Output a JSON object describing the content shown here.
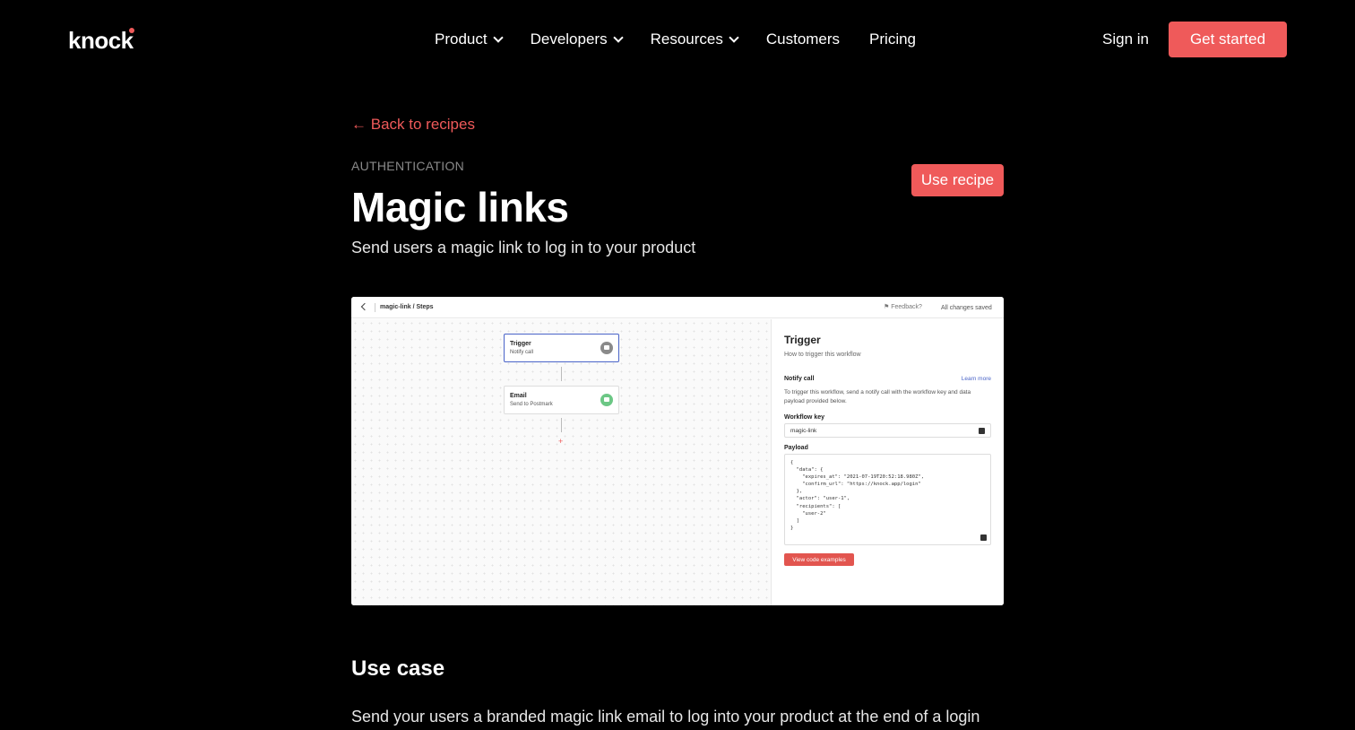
{
  "nav": {
    "logo": "knock",
    "links": [
      {
        "label": "Product",
        "dropdown": true
      },
      {
        "label": "Developers",
        "dropdown": true
      },
      {
        "label": "Resources",
        "dropdown": true
      },
      {
        "label": "Customers",
        "dropdown": false
      },
      {
        "label": "Pricing",
        "dropdown": false
      }
    ],
    "sign_in": "Sign in",
    "get_started": "Get started"
  },
  "header": {
    "back_label": "Back to recipes",
    "eyebrow": "AUTHENTICATION",
    "title": "Magic links",
    "subtitle": "Send users a magic link to log in to your product",
    "use_recipe": "Use recipe"
  },
  "screenshot": {
    "breadcrumb": "magic-link / Steps",
    "feedback": "Feedback?",
    "saved": "All changes saved",
    "nodes": [
      {
        "title": "Trigger",
        "subtitle": "Notify call",
        "icon": "flag-icon",
        "icon_color": "#8a8a8a"
      },
      {
        "title": "Email",
        "subtitle": "Send to Postmark",
        "icon": "mail-icon",
        "icon_color": "#6cc785"
      }
    ],
    "add_step": "+",
    "panel": {
      "title": "Trigger",
      "subtitle": "How to trigger this workflow",
      "section": "Notify call",
      "learn_more": "Learn more",
      "description": "To trigger this workflow, send a notify call with the workflow key and data payload provided below.",
      "workflow_key_label": "Workflow key",
      "workflow_key": "magic-link",
      "payload_label": "Payload",
      "payload": "{\n  \"data\": {\n    \"expires_at\": \"2021-07-19T20:52:18.980Z\",\n    \"confirm_url\": \"https://knock.app/login\"\n  },\n  \"actor\": \"user-1\",\n  \"recipients\": [\n    \"user-2\"\n  ]\n}",
      "view_code": "View code examples"
    }
  },
  "use_case": {
    "heading": "Use case",
    "text": "Send your users a branded magic link email to log into your product at the end of a login"
  },
  "colors": {
    "accent": "#ef5a5a",
    "background": "#000000"
  }
}
